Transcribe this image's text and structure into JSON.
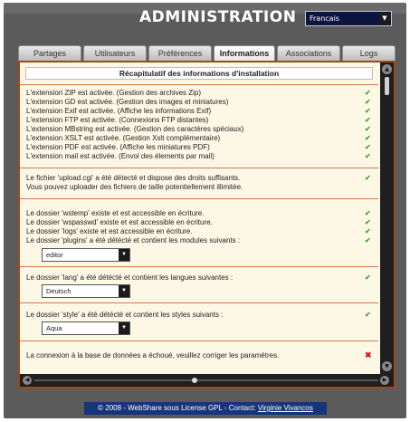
{
  "header": {
    "title": "ADMINISTRATION",
    "language": "Francais"
  },
  "tabs": [
    {
      "label": "Partages"
    },
    {
      "label": "Utilisateurs"
    },
    {
      "label": "Préférences"
    },
    {
      "label": "Informations",
      "active": true
    },
    {
      "label": "Associations"
    },
    {
      "label": "Logs"
    }
  ],
  "content": {
    "heading": "Récapitulatif des informations d'installation",
    "extensions": [
      "L'extension ZIP est activée. (Gestion des archives Zip)",
      "L'extension GD est activée. (Gestion des images et miniatures)",
      "L'extension Exif est activée. (Affiche les informations Exif)",
      "L'extension FTP est activée. (Connexions FTP distantes)",
      "L'extension MBstring est activée. (Gestion des caractères spéciaux)",
      "L'extension XSLT est activée. (Gestion Xslt complémentaire)",
      "L'extension PDF est activée. (Affiche les miniatures PDF)",
      "L'extension mail est activée. (Envoi des élements par mail)"
    ],
    "upload": {
      "line1": "Le fichier 'upload.cgi' a été détecté et dispose des droits suffisants.",
      "line2": "Vous pouvez uploader des fichiers de taille potentiellement illimitée."
    },
    "folders": [
      "Le dossier 'wstemp' existe et est accessible en écriture.",
      "Le dossier 'wspasswd' existe et est accessible en écriture.",
      "Le dossier 'logs' existe et est accessible en écriture.",
      "Le dossier 'plugins' a été détécté et contient les modules suivants :"
    ],
    "plugins_select": "editor",
    "lang_text": "Le dossier 'lang' a été détécté et contient les langues suivantes :",
    "lang_select": "Deutsch",
    "style_text": "Le dossier 'style' a été détécté et contient les styles suivants :",
    "style_select": "Aqua",
    "db_error": "La connexion à la base de données a échoué, veuillez corriger les paramètres."
  },
  "footer": {
    "text": "© 2008 - WebShare sous License GPL - Contact: ",
    "link": "Virginie Vivancos"
  },
  "colors": {
    "ok": "#44a828",
    "error": "#cc2020",
    "panel_bg": "#fdf7e6",
    "panel_border": "#9c4a16",
    "footer_bg": "#17357a"
  }
}
